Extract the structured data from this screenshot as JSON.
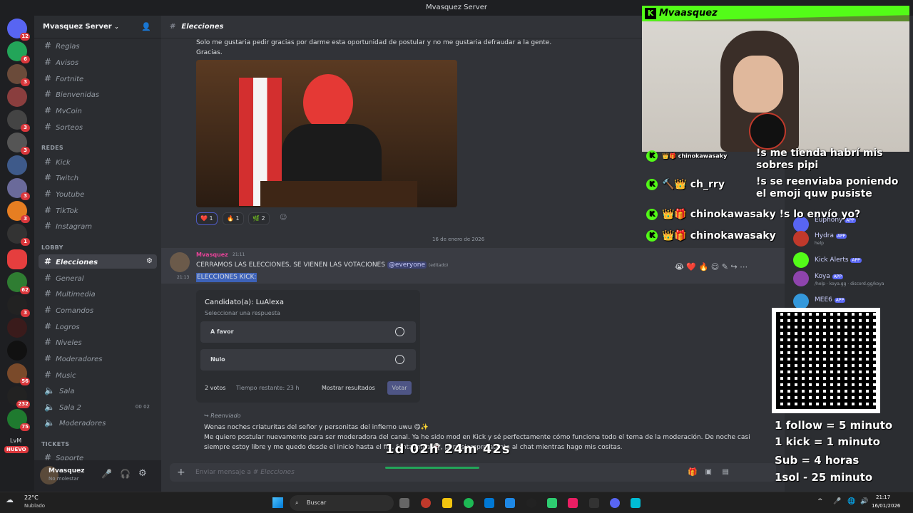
{
  "titlebar": {
    "title": "Mvasquez Server"
  },
  "server_badges": [
    "12",
    "6",
    "3",
    "",
    "3",
    "3",
    "",
    "3",
    "3",
    "",
    "1",
    "",
    "3",
    "1",
    "",
    "",
    "62",
    "",
    "",
    "",
    "",
    "56",
    "232",
    "75",
    ""
  ],
  "server_extra": {
    "new_label": "NUEVO",
    "lvm_label": "LvM"
  },
  "sidebar": {
    "server_name": "Mvasquez Server",
    "categories": {
      "redes": "REDES",
      "lobby": "LOBBY",
      "tickets": "TICKETS"
    },
    "top_channels": [
      "Reglas",
      "Avisos",
      "Fortnite",
      "Bienvenidas",
      "MvCoin",
      "Sorteos"
    ],
    "redes_channels": [
      "Kick",
      "Twitch",
      "Youtube",
      "TikTok",
      "Instagram"
    ],
    "lobby_channels": [
      "Elecciones",
      "General",
      "Multimedia",
      "Comandos",
      "Logros",
      "Niveles",
      "Moderadores",
      "Music",
      "Sala",
      "Sala 2",
      "Moderadores"
    ],
    "tickets_channels": [
      "Soporte"
    ],
    "sala2_counts": [
      "00",
      "02"
    ],
    "user": {
      "name": "Mvasquez",
      "status": "No molestar"
    }
  },
  "channel_header": {
    "name": "Elecciones"
  },
  "messages": {
    "top_text": "Solo me gustaria pedir gracias por darme esta oportunidad de postular y no me gustaria defraudar a la gente.",
    "top_text2": "Gracias.",
    "reactions": [
      {
        "emoji": "❤️",
        "count": "1"
      },
      {
        "emoji": "🔥",
        "count": "1"
      },
      {
        "emoji": "🌿",
        "count": "2"
      }
    ],
    "date_divider": "16 de enero de 2026",
    "author": "Mvasquez",
    "author_time": "21:11",
    "announce": "CERRAMOS LAS ELECCIONES, SE VIENEN LAS VOTACIONES",
    "mention": "@everyone",
    "edited": "(editado)",
    "second_time": "21:13",
    "second_text": "ELECCIONES KICK:",
    "poll": {
      "question": "Candidato(a): LuAlexa",
      "subtitle": "Seleccionar una respuesta",
      "options": [
        "A favor",
        "Nulo"
      ],
      "votes": "2 votos",
      "remaining": "Tiempo restante: 23 h",
      "show_results": "Mostrar resultados",
      "vote": "Votar"
    },
    "forwarded": "Reenviado",
    "fwd_line1": "Wenas noches criaturitas del señor y personitas del infierno uwu 😋✨",
    "fwd_line2": "Me quiero postular nuevamente para ser moderadora del canal. Ya he sido mod en Kick y sé perfectamente cómo funciona todo el tema de la moderación. De noche casi",
    "fwd_line3": "siempre estoy libre y me quedo desde el inicio hasta el fi… fantasmita 👻, pero siempre atenta al chat mientras hago mis cositas.",
    "composer_placeholder": "Enviar mensaje a #",
    "composer_channel": "Elecciones"
  },
  "overlay": {
    "streamer": "Mvaasquez",
    "chat": [
      {
        "user": "chinokawasaky",
        "text": "!s me tienda habrí mis sobres pipi"
      },
      {
        "user": "ch_rry",
        "text": "!s se reenviaba poniendo el emoji quw pusiste"
      },
      {
        "user": "chinokawasaky",
        "text": "!s lo envío yo?"
      },
      {
        "user": "chinokawasaky",
        "text": ""
      }
    ],
    "timer": "1d 02h 24m 42s",
    "goals": [
      "1 follow = 5 minuto",
      "1 kick = 1 minuto",
      "Sub = 4 horas",
      "1sol - 25 minuto"
    ]
  },
  "members": [
    {
      "name": "Euphony",
      "tag": "APP"
    },
    {
      "name": "Hydra",
      "tag": "APP",
      "sub": "help"
    },
    {
      "name": "Kick Alerts",
      "tag": "APP"
    },
    {
      "name": "Koya",
      "tag": "APP",
      "sub": "/help · koya.gg · discord.gg/koya"
    },
    {
      "name": "MEE6",
      "tag": "APP"
    }
  ],
  "taskbar": {
    "weather_temp": "22°C",
    "weather_desc": "Nublado",
    "search": "Buscar",
    "time": "21:17",
    "date": "16/01/2026"
  }
}
